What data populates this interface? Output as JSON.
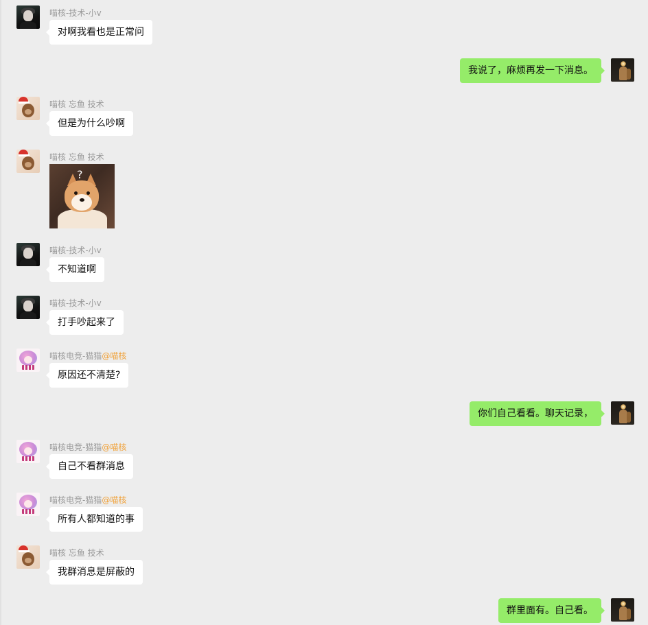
{
  "messages": [
    {
      "side": "left",
      "sender": "喵核-技术-小v",
      "mention": "",
      "text": "对啊我看也是正常问",
      "avatar": "dark-portrait-avatar"
    },
    {
      "side": "right",
      "text": "我说了，麻烦再发一下消息。",
      "avatar": "user-avatar"
    },
    {
      "side": "left",
      "sender": "喵核 忘鱼 技术",
      "mention": "",
      "text": "但是为什么吵啊",
      "avatar": "bear-avatar"
    },
    {
      "side": "left",
      "sender": "喵核 忘鱼 技术",
      "mention": "",
      "sticker": "confused-shiba-sticker",
      "sticker_text": "?",
      "avatar": "bear-avatar"
    },
    {
      "side": "left",
      "sender": "喵核-技术-小v",
      "mention": "",
      "text": "不知道啊",
      "avatar": "dark-portrait-avatar"
    },
    {
      "side": "left",
      "sender": "喵核-技术-小v",
      "mention": "",
      "text": "打手吵起来了",
      "avatar": "dark-portrait-avatar"
    },
    {
      "side": "left",
      "sender": "喵核电竞-猫猫",
      "mention": "@喵核",
      "text": "原因还不清楚?",
      "avatar": "pink-anime-avatar"
    },
    {
      "side": "right",
      "text": "你们自己看看。聊天记录，",
      "avatar": "user-avatar"
    },
    {
      "side": "left",
      "sender": "喵核电竞-猫猫",
      "mention": "@喵核",
      "text": "自己不看群消息",
      "avatar": "pink-anime-avatar"
    },
    {
      "side": "left",
      "sender": "喵核电竞-猫猫",
      "mention": "@喵核",
      "text": "所有人都知道的事",
      "avatar": "pink-anime-avatar"
    },
    {
      "side": "left",
      "sender": "喵核 忘鱼 技术",
      "mention": "",
      "text": "我群消息是屏蔽的",
      "avatar": "bear-avatar"
    },
    {
      "side": "right",
      "text": "群里面有。自己看。",
      "avatar": "user-avatar"
    }
  ],
  "colors": {
    "background": "#ededed",
    "left_bubble": "#ffffff",
    "right_bubble": "#95ec69",
    "sender_name": "#9a9a9a",
    "mention": "#f0a23b"
  }
}
